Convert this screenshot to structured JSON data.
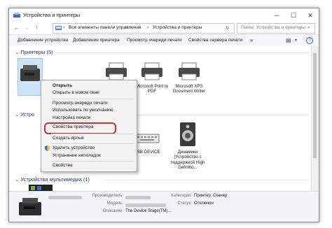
{
  "window": {
    "title": "Устройства и принтеры",
    "controls": {
      "minimize": "─",
      "maximize": "☐",
      "close": "✕"
    }
  },
  "address_bar": {
    "nav": {
      "back": "←",
      "forward": "→",
      "up": "↑"
    },
    "crumb_sep": "›",
    "breadcrumbs": [
      "Все элементы панели управления",
      "Устройства и принтеры"
    ],
    "refresh_icon": "↻",
    "search_placeholder": "Поиск: Устройства и принтеры",
    "search_icon": "⌕"
  },
  "toolbar": {
    "items": [
      "Добавление устройства",
      "Добавление принтера",
      "Просмотр очереди печати",
      "Свойства сервера печати"
    ],
    "more": "»",
    "view_icon": "▤",
    "help_icon": "?"
  },
  "sections": {
    "printers": {
      "header": "Принтеры (5)",
      "devices": [
        "Microsoft Print to PDF",
        "Microsoft XPS Document Writer"
      ]
    },
    "devices": {
      "header": "Устро",
      "devices": [
        "USB DEVICE",
        "Динамики (Устройство с поддержкой High Definitio..."
      ]
    },
    "multimedia": {
      "header": "Устройства мультимедиа (1)"
    }
  },
  "context_menu": {
    "items": [
      "Открыть",
      "Открыть в новом окне",
      "Просмотр очереди печати",
      "Использовать по умолчанию",
      "Настройка печати",
      "Свойства принтера",
      "Создать ярлык",
      "Удалить устройство",
      "Устранение неполадок",
      "Свойства"
    ],
    "highlighted": "Свойства принтера"
  },
  "details": {
    "manufacturer_key": "Производитель:",
    "model_key": "Модель:",
    "description_key": "Описание:",
    "description_value": "The Device Stage(TM)...",
    "category_key": "Категория:",
    "category_value": "Принтер; Сканер",
    "status_key": "Статус:",
    "status_value": "Отключен"
  },
  "colors": {
    "accent": "#1e3287",
    "highlight_border": "#c8303b",
    "toolbar_bg": "#f5f6f7",
    "details_bg": "#f2f4f8"
  }
}
